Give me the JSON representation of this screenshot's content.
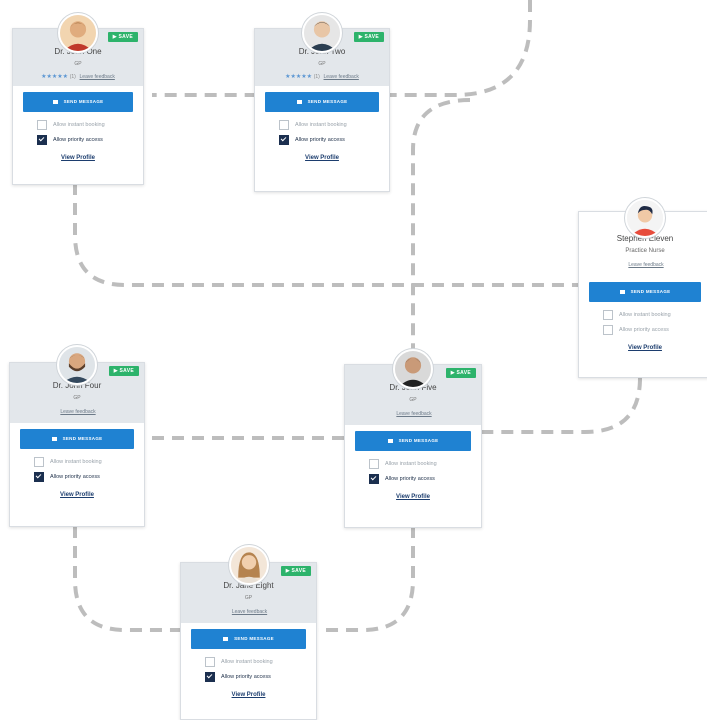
{
  "buttons": {
    "save": "SAVE",
    "send_message": "SEND MESSAGE",
    "view_profile": "View Profile",
    "leave_feedback": "Leave feedback"
  },
  "options": {
    "instant_booking": "Allow instant booking",
    "priority_access": "Allow priority access"
  },
  "cards": [
    {
      "name": "Dr. John One",
      "role": "GP",
      "rating": 5,
      "stars": "★★★★★",
      "review_count": "(1)",
      "saved": true,
      "instant_booking": false,
      "priority_access": true
    },
    {
      "name": "Dr. John Two",
      "role": "GP",
      "rating": 5,
      "stars": "★★★★★",
      "review_count": "(1)",
      "saved": true,
      "instant_booking": false,
      "priority_access": true
    },
    {
      "name": "Stephen Eleven",
      "role": "Practice Nurse",
      "saved": false,
      "instant_booking": false,
      "priority_access": false
    },
    {
      "name": "Dr. John Four",
      "role": "GP",
      "saved": true,
      "instant_booking": false,
      "priority_access": true
    },
    {
      "name": "Dr. John Five",
      "role": "GP",
      "saved": true,
      "instant_booking": false,
      "priority_access": true
    },
    {
      "name": "Dr. Jane Eight",
      "role": "GP",
      "saved": true,
      "instant_booking": false,
      "priority_access": true
    }
  ],
  "colors": {
    "primary_button": "#1f82d2",
    "save_badge": "#2db36b",
    "checkbox_checked": "#1b2f4f",
    "connector": "#bdbdbd",
    "header_bg": "#e3e7eb",
    "star": "#5b96d3"
  }
}
